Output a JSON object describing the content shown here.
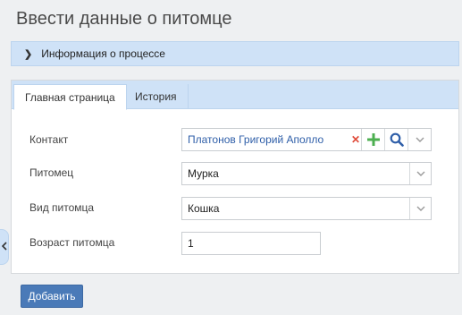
{
  "page": {
    "title": "Ввести данные о питомце"
  },
  "process_info": {
    "label": "Информация о процессе"
  },
  "tabs": [
    {
      "label": "Главная страница",
      "active": true
    },
    {
      "label": "История",
      "active": false
    }
  ],
  "form": {
    "contact": {
      "label": "Контакт",
      "value": "Платонов Григорий Аполло"
    },
    "pet": {
      "label": "Питомец",
      "value": "Мурка"
    },
    "pet_type": {
      "label": "Вид питомца",
      "value": "Кошка"
    },
    "pet_age": {
      "label": "Возраст питомца",
      "value": "1"
    }
  },
  "actions": {
    "add_label": "Добавить"
  },
  "colors": {
    "accent_bar": "#cfe2f7",
    "link_blue": "#2e5ea8",
    "primary_button": "#4a7ab8",
    "add_icon": "#4caf50",
    "clear_icon": "#e04b3a"
  },
  "icons": {
    "process_toggle": "chevron-right-icon",
    "clear": "close-icon",
    "add": "plus-icon",
    "search": "search-icon",
    "dropdown": "chevron-down-icon",
    "collapse": "chevron-left-icon"
  }
}
